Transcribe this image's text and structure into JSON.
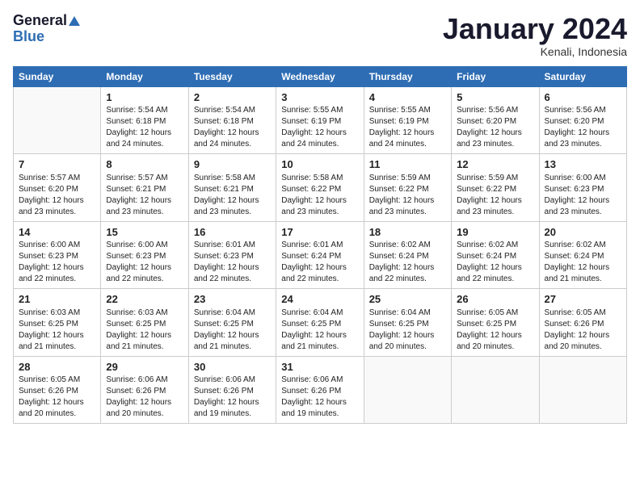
{
  "header": {
    "logo_line1": "General",
    "logo_line2": "Blue",
    "month_title": "January 2024",
    "subtitle": "Kenali, Indonesia"
  },
  "days_of_week": [
    "Sunday",
    "Monday",
    "Tuesday",
    "Wednesday",
    "Thursday",
    "Friday",
    "Saturday"
  ],
  "weeks": [
    [
      {
        "day": "",
        "info": ""
      },
      {
        "day": "1",
        "info": "Sunrise: 5:54 AM\nSunset: 6:18 PM\nDaylight: 12 hours\nand 24 minutes."
      },
      {
        "day": "2",
        "info": "Sunrise: 5:54 AM\nSunset: 6:18 PM\nDaylight: 12 hours\nand 24 minutes."
      },
      {
        "day": "3",
        "info": "Sunrise: 5:55 AM\nSunset: 6:19 PM\nDaylight: 12 hours\nand 24 minutes."
      },
      {
        "day": "4",
        "info": "Sunrise: 5:55 AM\nSunset: 6:19 PM\nDaylight: 12 hours\nand 24 minutes."
      },
      {
        "day": "5",
        "info": "Sunrise: 5:56 AM\nSunset: 6:20 PM\nDaylight: 12 hours\nand 23 minutes."
      },
      {
        "day": "6",
        "info": "Sunrise: 5:56 AM\nSunset: 6:20 PM\nDaylight: 12 hours\nand 23 minutes."
      }
    ],
    [
      {
        "day": "7",
        "info": "Sunrise: 5:57 AM\nSunset: 6:20 PM\nDaylight: 12 hours\nand 23 minutes."
      },
      {
        "day": "8",
        "info": "Sunrise: 5:57 AM\nSunset: 6:21 PM\nDaylight: 12 hours\nand 23 minutes."
      },
      {
        "day": "9",
        "info": "Sunrise: 5:58 AM\nSunset: 6:21 PM\nDaylight: 12 hours\nand 23 minutes."
      },
      {
        "day": "10",
        "info": "Sunrise: 5:58 AM\nSunset: 6:22 PM\nDaylight: 12 hours\nand 23 minutes."
      },
      {
        "day": "11",
        "info": "Sunrise: 5:59 AM\nSunset: 6:22 PM\nDaylight: 12 hours\nand 23 minutes."
      },
      {
        "day": "12",
        "info": "Sunrise: 5:59 AM\nSunset: 6:22 PM\nDaylight: 12 hours\nand 23 minutes."
      },
      {
        "day": "13",
        "info": "Sunrise: 6:00 AM\nSunset: 6:23 PM\nDaylight: 12 hours\nand 23 minutes."
      }
    ],
    [
      {
        "day": "14",
        "info": "Sunrise: 6:00 AM\nSunset: 6:23 PM\nDaylight: 12 hours\nand 22 minutes."
      },
      {
        "day": "15",
        "info": "Sunrise: 6:00 AM\nSunset: 6:23 PM\nDaylight: 12 hours\nand 22 minutes."
      },
      {
        "day": "16",
        "info": "Sunrise: 6:01 AM\nSunset: 6:23 PM\nDaylight: 12 hours\nand 22 minutes."
      },
      {
        "day": "17",
        "info": "Sunrise: 6:01 AM\nSunset: 6:24 PM\nDaylight: 12 hours\nand 22 minutes."
      },
      {
        "day": "18",
        "info": "Sunrise: 6:02 AM\nSunset: 6:24 PM\nDaylight: 12 hours\nand 22 minutes."
      },
      {
        "day": "19",
        "info": "Sunrise: 6:02 AM\nSunset: 6:24 PM\nDaylight: 12 hours\nand 22 minutes."
      },
      {
        "day": "20",
        "info": "Sunrise: 6:02 AM\nSunset: 6:24 PM\nDaylight: 12 hours\nand 21 minutes."
      }
    ],
    [
      {
        "day": "21",
        "info": "Sunrise: 6:03 AM\nSunset: 6:25 PM\nDaylight: 12 hours\nand 21 minutes."
      },
      {
        "day": "22",
        "info": "Sunrise: 6:03 AM\nSunset: 6:25 PM\nDaylight: 12 hours\nand 21 minutes."
      },
      {
        "day": "23",
        "info": "Sunrise: 6:04 AM\nSunset: 6:25 PM\nDaylight: 12 hours\nand 21 minutes."
      },
      {
        "day": "24",
        "info": "Sunrise: 6:04 AM\nSunset: 6:25 PM\nDaylight: 12 hours\nand 21 minutes."
      },
      {
        "day": "25",
        "info": "Sunrise: 6:04 AM\nSunset: 6:25 PM\nDaylight: 12 hours\nand 20 minutes."
      },
      {
        "day": "26",
        "info": "Sunrise: 6:05 AM\nSunset: 6:25 PM\nDaylight: 12 hours\nand 20 minutes."
      },
      {
        "day": "27",
        "info": "Sunrise: 6:05 AM\nSunset: 6:26 PM\nDaylight: 12 hours\nand 20 minutes."
      }
    ],
    [
      {
        "day": "28",
        "info": "Sunrise: 6:05 AM\nSunset: 6:26 PM\nDaylight: 12 hours\nand 20 minutes."
      },
      {
        "day": "29",
        "info": "Sunrise: 6:06 AM\nSunset: 6:26 PM\nDaylight: 12 hours\nand 20 minutes."
      },
      {
        "day": "30",
        "info": "Sunrise: 6:06 AM\nSunset: 6:26 PM\nDaylight: 12 hours\nand 19 minutes."
      },
      {
        "day": "31",
        "info": "Sunrise: 6:06 AM\nSunset: 6:26 PM\nDaylight: 12 hours\nand 19 minutes."
      },
      {
        "day": "",
        "info": ""
      },
      {
        "day": "",
        "info": ""
      },
      {
        "day": "",
        "info": ""
      }
    ]
  ]
}
